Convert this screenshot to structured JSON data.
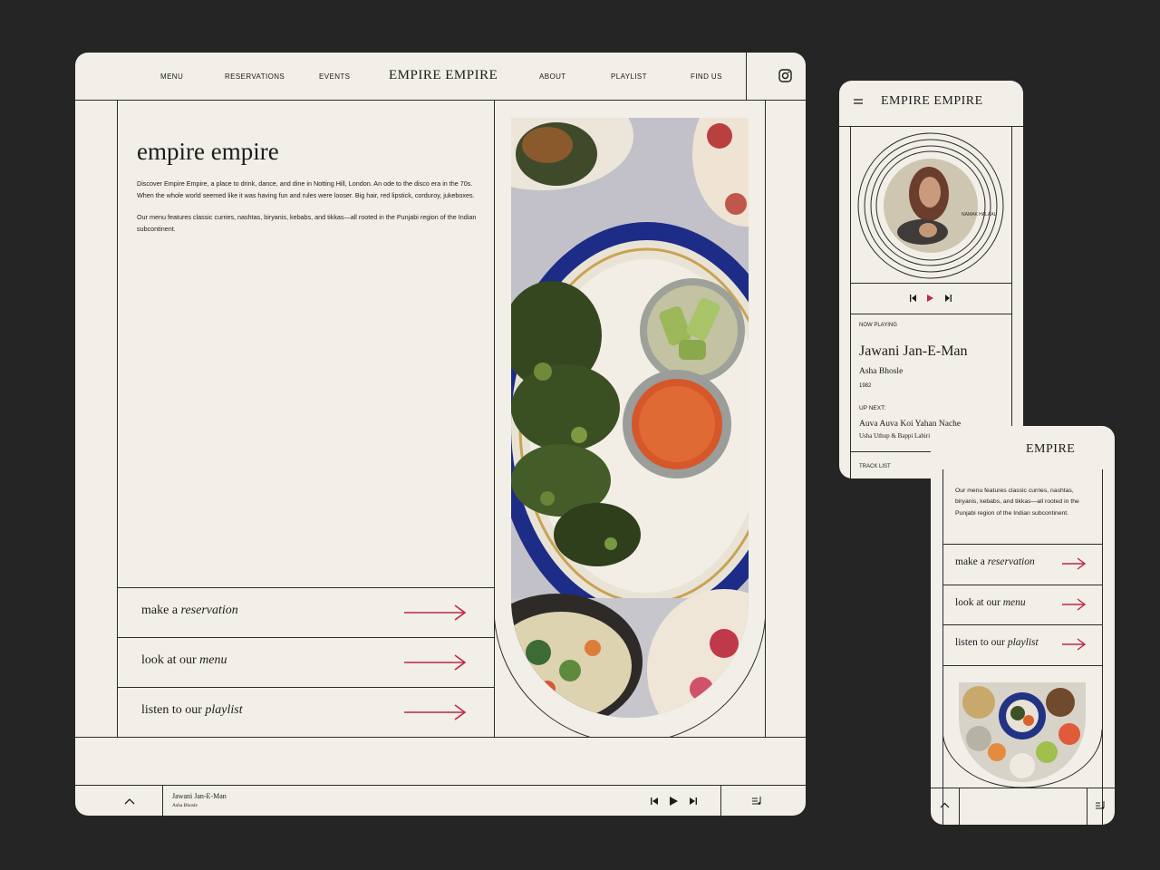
{
  "desktop": {
    "nav": {
      "left": [
        "MENU",
        "RESERVATIONS",
        "EVENTS"
      ],
      "logo": "EMPIRE EMPIRE",
      "right": [
        "ABOUT",
        "PLAYLIST",
        "FIND US"
      ]
    },
    "intro": {
      "title": "empire empire",
      "p1": "Discover Empire Empire, a place to drink, dance, and dine in Notting Hill, London. An ode to the disco era in the 70s. When the whole world seemed like it was having fun and rules were looser. Big hair, red lipstick, corduroy, jukeboxes.",
      "p2": "Our menu features classic curries, nashtas, biryanis, kebabs, and tikkas—all rooted in the Punjabi region of the Indian subcontinent."
    },
    "ctas": [
      {
        "pre": "make a ",
        "em": "reservation"
      },
      {
        "pre": "look at our ",
        "em": "menu"
      },
      {
        "pre": "listen to our ",
        "em": "playlist"
      }
    ],
    "player": {
      "track": "Jawani Jan-E-Man",
      "artist": "Asha Bhosle"
    }
  },
  "mobile_player": {
    "logo": "EMPIRE EMPIRE",
    "album_text": "NAMAK HALAAL",
    "now_playing_label": "NOW PLAYING",
    "track": "Jawani Jan-E-Man",
    "artist": "Asha Bhosle",
    "year": "1982",
    "up_next_label": "UP NEXT:",
    "next_track": "Auva Auva Koi Yahan Nache",
    "next_artist": "Usha Uthup & Bappi Lahiri",
    "tracklist_label": "TRACK LIST"
  },
  "mobile_home": {
    "logo": "EMPIRE",
    "p": "Our menu features classic curries, nashtas, biryanis, kebabs, and tikkas—all rooted in the Punjabi region of the Indian subcontinent.",
    "ctas": [
      {
        "pre": "make a ",
        "em": "reservation"
      },
      {
        "pre": "look at our ",
        "em": "menu"
      },
      {
        "pre": "listen to our ",
        "em": "playlist"
      }
    ]
  },
  "colors": {
    "background": "#252525",
    "card": "#f2eee8",
    "line": "#2b2b2b",
    "accent": "#b8294a"
  },
  "icons": [
    "instagram-icon",
    "hamburger-icon",
    "previous-icon",
    "play-icon",
    "next-icon",
    "chevron-up-icon",
    "playlist-icon",
    "arrow-right-icon"
  ]
}
